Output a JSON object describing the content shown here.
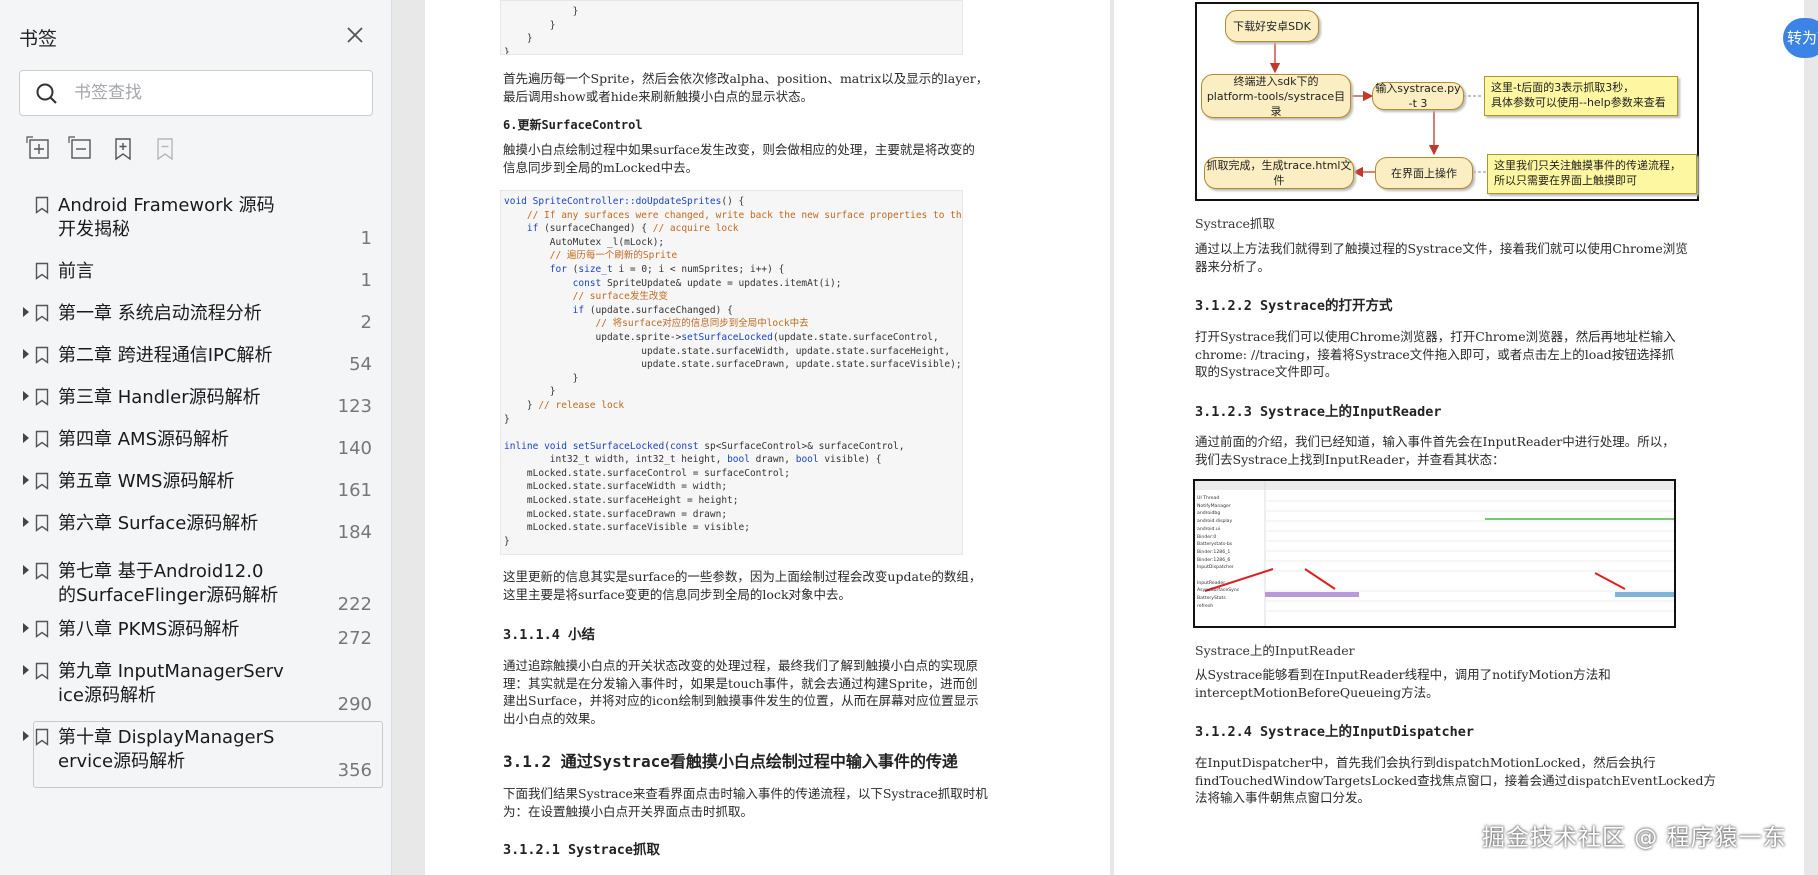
{
  "sidebar": {
    "title": "书签",
    "search_placeholder": "书签查找",
    "items": [
      {
        "title": "Android Framework 源码\n开发揭秘",
        "page": "1",
        "expandable": false
      },
      {
        "title": "前言",
        "page": "1",
        "expandable": false
      },
      {
        "title": "第一章 系统启动流程分析",
        "page": "2",
        "expandable": true
      },
      {
        "title": "第二章 跨进程通信IPC解析",
        "page": "54",
        "expandable": true
      },
      {
        "title": "第三章 Handler源码解析",
        "page": "123",
        "expandable": true
      },
      {
        "title": "第四章 AMS源码解析",
        "page": "140",
        "expandable": true
      },
      {
        "title": "第五章 WMS源码解析",
        "page": "161",
        "expandable": true
      },
      {
        "title": "第六章 Surface源码解析",
        "page": "184",
        "expandable": true
      },
      {
        "title": "第七章 基于Android12.0\n的SurfaceFlinger源码解析",
        "page": "222",
        "expandable": true
      },
      {
        "title": "第八章 PKMS源码解析",
        "page": "272",
        "expandable": true
      },
      {
        "title": "第九章 InputManagerServ\nice源码解析",
        "page": "290",
        "expandable": true
      },
      {
        "title": "第十章 DisplayManagerS\nervice源码解析",
        "page": "356",
        "expandable": true
      }
    ]
  },
  "left_page": {
    "code_top": "            }\n        }\n    }\n}",
    "para1": "首先遍历每一个Sprite，然后会依次修改alpha、position、matrix以及显示的layer，\n最后调用show或者hide来刷新触摸小白点的显示状态。",
    "heading_6": "6.更新SurfaceControl",
    "para2": "触摸小白点绘制过程中如果surface发生改变，则会做相应的处理，主要就是将改变的\n信息同步到全局的mLocked中去。",
    "code_main_lines": [
      "void SpriteController::doUpdateSprites() {",
      "    // If any surfaces were changed, write back the new surface properties to the sprites.",
      "    if (surfaceChanged) { // acquire lock",
      "        AutoMutex _l(mLock);",
      "        // 遍历每一个刷新的Sprite",
      "        for (size_t i = 0; i < numSprites; i++) {",
      "            const SpriteUpdate& update = updates.itemAt(i);",
      "            // surface发生改变",
      "            if (update.surfaceChanged) {",
      "                // 将surface对应的信息同步到全局中lock中去",
      "                update.sprite->setSurfaceLocked(update.state.surfaceControl,",
      "                        update.state.surfaceWidth, update.state.surfaceHeight,",
      "                        update.state.surfaceDrawn, update.state.surfaceVisible);",
      "            }",
      "        }",
      "    } // release lock",
      "}",
      "",
      "inline void setSurfaceLocked(const sp<SurfaceControl>& surfaceControl,",
      "        int32_t width, int32_t height, bool drawn, bool visible) {",
      "    mLocked.state.surfaceControl = surfaceControl;",
      "    mLocked.state.surfaceWidth = width;",
      "    mLocked.state.surfaceHeight = height;",
      "    mLocked.state.surfaceDrawn = drawn;",
      "    mLocked.state.surfaceVisible = visible;",
      "}"
    ],
    "para3": "这里更新的信息其实是surface的一些参数，因为上面绘制过程会改变update的数组，\n这里主要是将surface变更的信息同步到全局的lock对象中去。",
    "heading_3114": "3.1.1.4 小结",
    "para4": "通过追踪触摸小白点的开关状态改变的处理过程，最终我们了解到触摸小白点的实现原\n理：其实就是在分发输入事件时，如果是touch事件，就会去通过构建Sprite，进而创\n建出Surface，并将对应的icon绘制到触摸事件发生的位置，从而在屏幕对应位置显示\n出小白点的效果。",
    "heading_312": "3.1.2 通过Systrace看触摸小白点绘制过程中输入事件的传递",
    "para5": "下面我们结果Systrace来查看界面点击时输入事件的传递流程，以下Systrace抓取时机\n为：在设置触摸小白点开关界面点击时抓取。",
    "heading_3121": "3.1.2.1 Systrace抓取"
  },
  "right_page": {
    "flow": {
      "n1": "下载好安卓SDK",
      "n2": "终端进入sdk下的\nplatform-tools/systrace目录",
      "n3": "输入systrace.py -t 3",
      "note1": "这里-t后面的3表示抓取3秒，\n具体参数可以使用--help参数来查看",
      "n4": "抓取完成，生成trace.html文件",
      "n5": "在界面上操作",
      "note2": "这里我们只关注触摸事件的传递流程，\n所以只需要在界面上触摸即可"
    },
    "cap1": "Systrace抓取",
    "para1": "通过以上方法我们就得到了触摸过程的Systrace文件，接着我们就可以使用Chrome浏览\n器来分析了。",
    "heading_3122": "3.1.2.2 Systrace的打开方式",
    "para2": "打开Systrace我们可以使用Chrome浏览器，打开Chrome浏览器，然后再地址栏输入\nchrome: //tracing，接着将Systrace文件拖入即可，或者点击左上的load按钮选择抓\n取的Systrace文件即可。",
    "heading_3123": "3.1.2.3 Systrace上的InputReader",
    "para3": "通过前面的介绍，我们已经知道，输入事件首先会在InputReader中进行处理。所以，\n我们去Systrace上找到InputReader，并查看其状态：",
    "trace_labels": [
      "UI Thread",
      "NotifyManager",
      "androidbg",
      "android.display",
      "android.ui",
      "Binder:0",
      "Batterystats-bs",
      "Binder:1286_1",
      "Binder:1286_6",
      "InputDispatcher",
      "",
      "InputReader",
      "AsyncSurfaceSync",
      "BatteryStats",
      "refresh"
    ],
    "cap2": "Systrace上的InputReader",
    "para4": "从Systrace能够看到在InputReader线程中，调用了notifyMotion方法和\ninterceptMotionBeforeQueueing方法。",
    "heading_3124": "3.1.2.4 Systrace上的InputDispatcher",
    "para5": "在InputDispatcher中，首先我们会执行到dispatchMotionLocked，然后会执行\nfindTouchedWindowTargetsLocked查找焦点窗口，接着会通过dispatchEventLocked方\n法将输入事件朝焦点窗口分发。"
  },
  "watermark": "掘金技术社区 @ 程序猿一东",
  "fab_label": "转为W"
}
